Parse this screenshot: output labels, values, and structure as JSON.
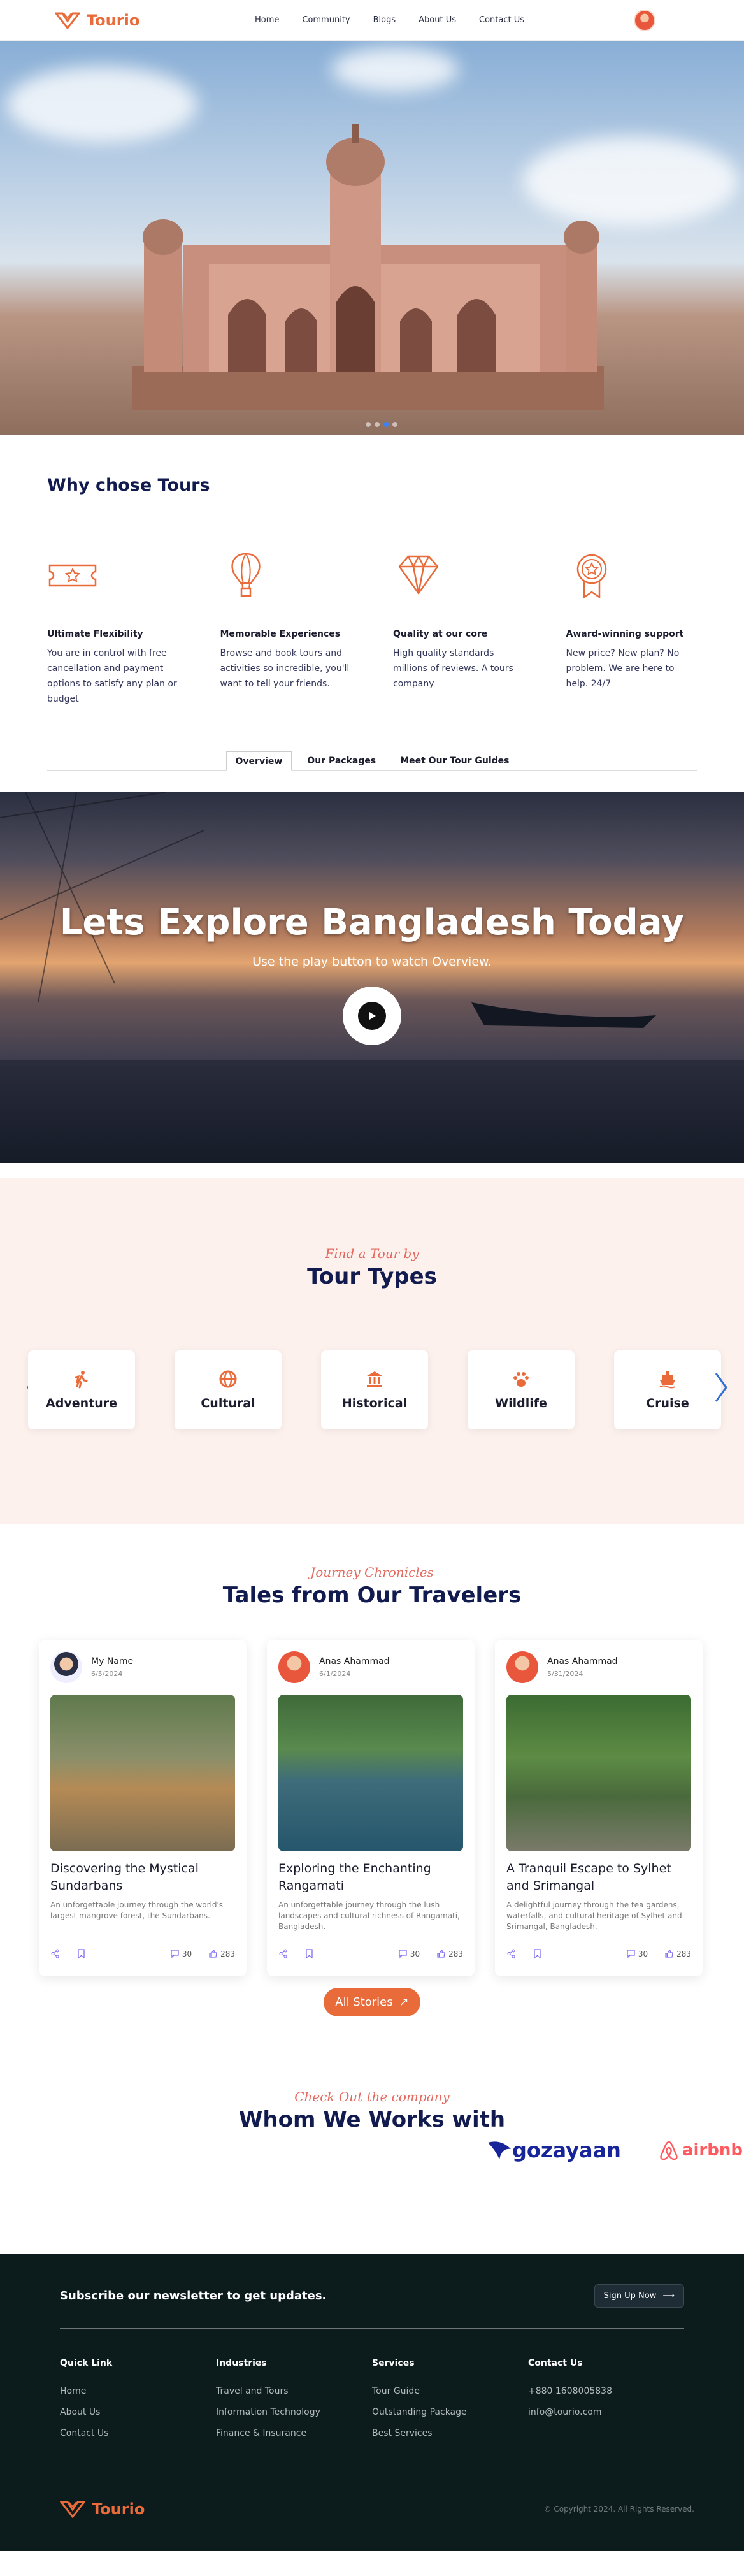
{
  "nav": {
    "brand": "Tourio",
    "items": [
      "Home",
      "Community",
      "Blogs",
      "About Us",
      "Contact Us"
    ]
  },
  "why": {
    "title": "Why chose Tours",
    "features": [
      {
        "icon": "ticket-icon",
        "title": "Ultimate Flexibility",
        "text": "You are in control with free cancellation and payment options to satisfy any plan or budget"
      },
      {
        "icon": "hot-air-balloon-icon",
        "title": "Memorable Experiences",
        "text": "Browse and book tours and activities so incredible, you'll want to tell your friends."
      },
      {
        "icon": "diamond-icon",
        "title": "Quality at our core",
        "text": "High quality standards millions of reviews. A tours company"
      },
      {
        "icon": "award-medal-icon",
        "title": "Award-winning support",
        "text": "New price? New plan? No problem. We are here to help. 24/7"
      }
    ]
  },
  "tabs": [
    "Overview",
    "Our Packages",
    "Meet Our Tour Guides"
  ],
  "video": {
    "title": "Lets Explore Bangladesh Today",
    "subtitle": "Use the play button to watch Overview."
  },
  "types": {
    "kicker": "Find a Tour by",
    "title": "Tour Types",
    "items": [
      {
        "icon": "hiking-icon",
        "label": "Adventure"
      },
      {
        "icon": "globe-icon",
        "label": "Cultural"
      },
      {
        "icon": "landmark-icon",
        "label": "Historical"
      },
      {
        "icon": "paw-icon",
        "label": "Wildlife"
      },
      {
        "icon": "ship-icon",
        "label": "Cruise"
      }
    ]
  },
  "tales": {
    "kicker": "Journey Chronicles",
    "title": "Tales from Our Travelers",
    "button": "All Stories",
    "stories": [
      {
        "author": "My Name",
        "date": "6/5/2024",
        "title": "Discovering the Mystical Sundarbans",
        "text": "An unforgettable journey through the world's largest mangrove forest, the Sundarbans.",
        "comments": "30",
        "likes": "283"
      },
      {
        "author": "Anas Ahammad",
        "date": "6/1/2024",
        "title": "Exploring the Enchanting Rangamati",
        "text": "An unforgettable journey through the lush landscapes and cultural richness of Rangamati, Bangladesh.",
        "comments": "30",
        "likes": "283"
      },
      {
        "author": "Anas Ahammad",
        "date": "5/31/2024",
        "title": "A Tranquil Escape to Sylhet and Srimangal",
        "text": "A delightful journey through the tea gardens, waterfalls, and cultural heritage of Sylhet and Srimangal, Bangladesh.",
        "comments": "30",
        "likes": "283"
      }
    ]
  },
  "partners": {
    "kicker": "Check Out the company",
    "title": "Whom We Works with",
    "logos": [
      "gozayaan",
      "airbnb"
    ]
  },
  "footer": {
    "newsletter": "Subscribe our newsletter to get updates.",
    "signup": "Sign Up Now",
    "columns": [
      {
        "title": "Quick Link",
        "links": [
          "Home",
          "About Us",
          "Contact Us"
        ]
      },
      {
        "title": "Industries",
        "links": [
          "Travel and Tours",
          "Information Technology",
          "Finance & Insurance"
        ]
      },
      {
        "title": "Services",
        "links": [
          "Tour Guide",
          "Outstanding Package",
          "Best Services"
        ]
      },
      {
        "title": "Contact Us",
        "links": [
          "+880 1608005838",
          "info@tourio.com"
        ]
      }
    ],
    "brand": "Tourio",
    "copyright": "© Copyright 2024. All Rights Reserved."
  },
  "colors": {
    "accent": "#ea6b3a",
    "navy": "#121b4f",
    "script": "#e46a5f",
    "footer_bg": "#0c1b1c"
  }
}
